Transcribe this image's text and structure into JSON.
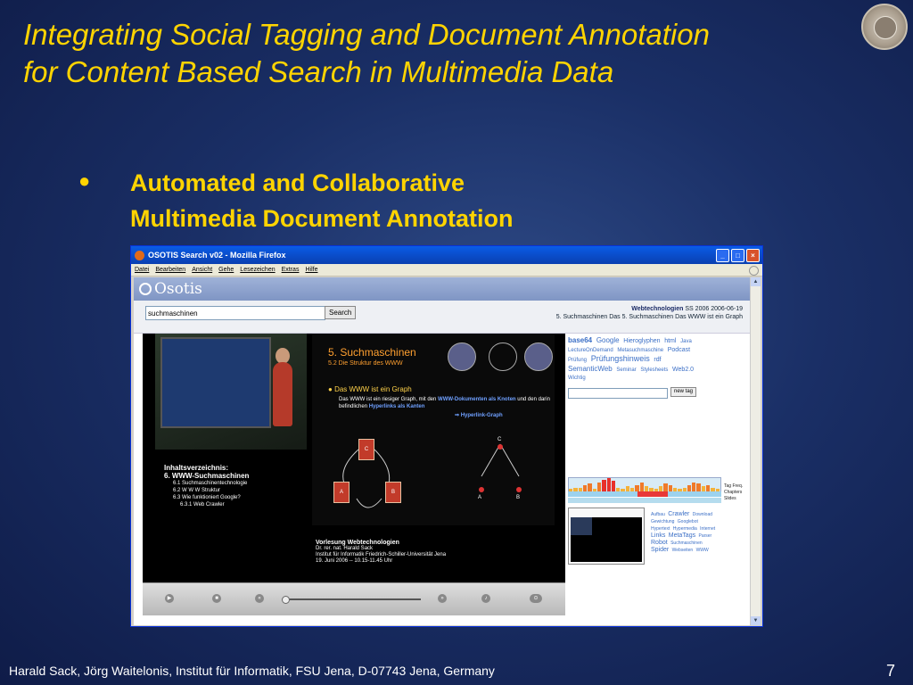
{
  "slide": {
    "title_line1": "Integrating Social Tagging and Document Annotation",
    "title_line2": "for Content Based Search in Multimedia Data",
    "bullet_line1": "Automated and Collaborative",
    "bullet_line2": "Multimedia Document Annotation",
    "footer": "Harald Sack, Jörg Waitelonis, Institut für Informatik, FSU Jena, D-07743 Jena, Germany",
    "page_number": "7"
  },
  "browser": {
    "window_title": "OSOTIS Search v02 - Mozilla Firefox",
    "menu": [
      "Datei",
      "Bearbeiten",
      "Ansicht",
      "Gehe",
      "Lesezeichen",
      "Extras",
      "Hilfe"
    ]
  },
  "osotis": {
    "app_name": "Osotis",
    "search_value": "suchmaschinen",
    "search_button": "Search",
    "lecture_title": "Webtechnologien",
    "lecture_term": "SS 2006 2006-06-19",
    "lecture_path": "5. Suchmaschinen Das 5. Suchmaschinen Das WWW ist ein Graph"
  },
  "video": {
    "toc_title": "Inhaltsverzeichnis:",
    "toc_chapter": "6. WWW-Suchmaschinen",
    "toc_items": [
      "6.1 Suchmaschinentechnologie",
      "6.2 W W W Struktur",
      "6.3 Wie funktioniert Google?",
      "6.3.1 Web Crawler"
    ],
    "slide_title": "5. Suchmaschinen",
    "slide_subtitle": "5.2 Die Struktur des WWW",
    "slide_bullet": "Das WWW ist ein Graph",
    "slide_text_1": "Das WWW ist ein riesiger Graph, mit den",
    "slide_text_hl1": "WWW-Dokumenten als Knoten",
    "slide_text_2": "und den darin befindlichen",
    "slide_text_hl2": "Hyperlinks als Kanten",
    "hyperlink_label": "Hyperlink-Graph",
    "doc_a": "A",
    "doc_b": "B",
    "doc_c": "C",
    "caption_title": "Vorlesung Webtechnologien",
    "caption_author": "Dr. rer. nat. Harald Sack",
    "caption_institute": "Institut für Informatik Friedrich-Schiller-Universität Jena",
    "caption_date": "19. Juni 2006 -- 10.15-11.45 Uhr"
  },
  "tags": {
    "cloud": [
      "base64",
      "Google",
      "Hieroglyphen",
      "html",
      "Java",
      "LectureOnDemand",
      "Metasuchmaschine",
      "Podcast",
      "Prüfung",
      "Prüfungshinweis",
      "rdf",
      "SemanticWeb",
      "Seminar",
      "Stylesheets",
      "Web2.0",
      "Wichtig"
    ],
    "new_tag_button": "new tag",
    "legend": [
      "Tag Freq.",
      "Chapters",
      "Slides"
    ],
    "freq_levels": [
      0.2,
      0.3,
      0.25,
      0.5,
      0.6,
      0.2,
      0.7,
      0.9,
      1.0,
      0.8,
      0.3,
      0.2,
      0.4,
      0.3,
      0.5,
      0.7,
      0.4,
      0.3,
      0.2,
      0.4,
      0.6,
      0.5,
      0.3,
      0.2,
      0.3,
      0.5,
      0.7,
      0.6,
      0.4,
      0.5,
      0.3,
      0.2
    ],
    "cloud2": [
      "Aufbau",
      "Crawler",
      "Download",
      "Gewichtung",
      "Googlebot",
      "Hypertext",
      "Hypermedia",
      "Internet",
      "Links",
      "MetaTags",
      "Parser",
      "Robot",
      "Suchmaschinen",
      "Spider",
      "Webseiten",
      "WWW"
    ]
  }
}
